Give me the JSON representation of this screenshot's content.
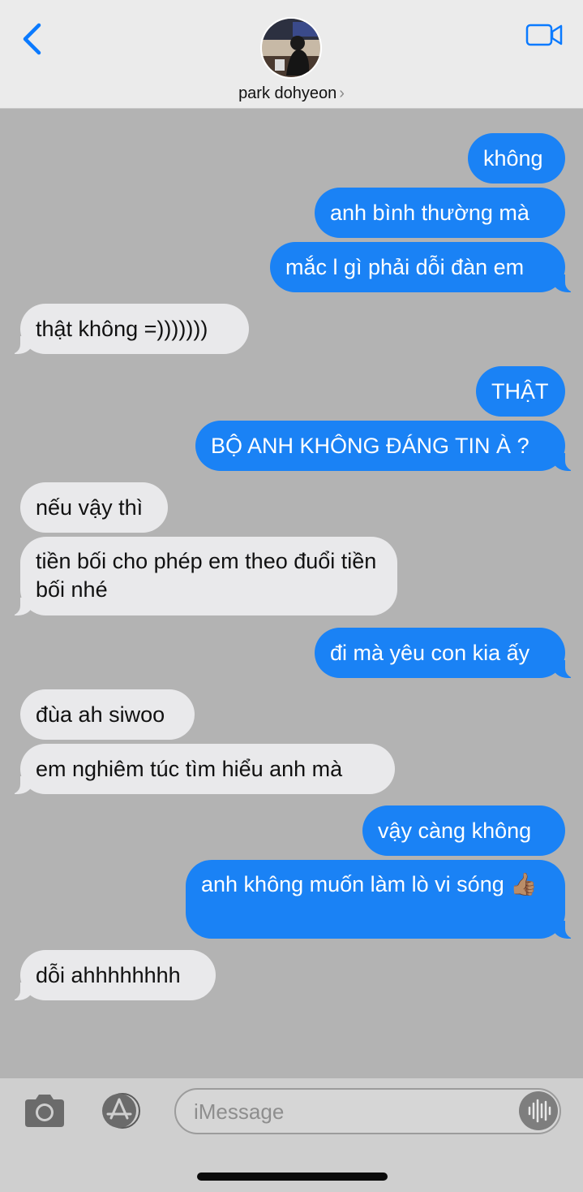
{
  "header": {
    "contact_name": "park dohyeon",
    "chevron": "›",
    "icons": {
      "back": "chevron-left-icon",
      "video": "video-camera-icon"
    },
    "accent_color": "#0a7aff"
  },
  "messages": [
    {
      "side": "sent",
      "text": "không"
    },
    {
      "side": "sent",
      "text": "anh bình thường mà"
    },
    {
      "side": "sent",
      "text": "mắc l gì phải dỗi đàn em"
    },
    {
      "side": "received",
      "text": "thật không =)))))))"
    },
    {
      "side": "sent",
      "text": "THẬT"
    },
    {
      "side": "sent",
      "text": "BỘ ANH KHÔNG ĐÁNG TIN À ?"
    },
    {
      "side": "received",
      "text": "nếu vậy thì"
    },
    {
      "side": "received",
      "text": "tiền bối cho phép em theo đuổi tiền bối nhé"
    },
    {
      "side": "sent",
      "text": "đi mà yêu con kia ấy"
    },
    {
      "side": "received",
      "text": "đùa ah siwoo"
    },
    {
      "side": "received",
      "text": "em nghiêm túc tìm hiểu anh mà"
    },
    {
      "side": "sent",
      "text": "vậy càng không"
    },
    {
      "side": "sent",
      "text": "anh không muốn làm lò vi sóng 👍🏽"
    },
    {
      "side": "received",
      "text": "dỗi ahhhhhhhh"
    }
  ],
  "colors": {
    "sent_bubble": "#1a82f5",
    "received_bubble": "#e9e9eb",
    "background": "#b3b3b3"
  },
  "input": {
    "placeholder": "iMessage",
    "icons": {
      "camera": "camera-icon",
      "apps": "app-store-icon",
      "audio": "audio-waveform-icon"
    }
  }
}
